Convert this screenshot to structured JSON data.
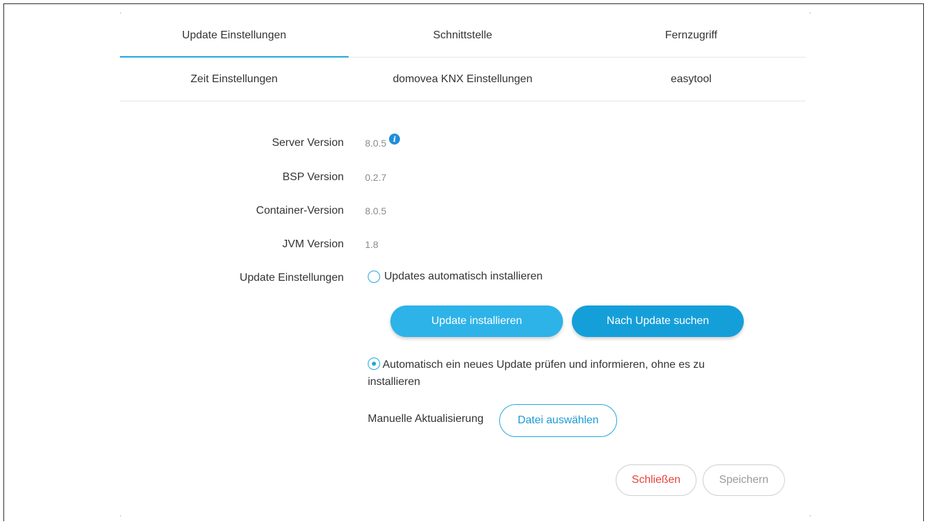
{
  "tabs": {
    "row1": [
      "Update Einstellungen",
      "Schnittstelle",
      "Fernzugriff"
    ],
    "row2": [
      "Zeit Einstellungen",
      "domovea KNX Einstellungen",
      "easytool"
    ],
    "active": "Update Einstellungen"
  },
  "info": {
    "server": {
      "label": "Server Version",
      "value": "8.0.5",
      "icon": "info-icon"
    },
    "bsp": {
      "label": "BSP Version",
      "value": "0.2.7"
    },
    "container": {
      "label": "Container-Version",
      "value": "8.0.5"
    },
    "jvm": {
      "label": "JVM Version",
      "value": "1.8"
    }
  },
  "update_settings": {
    "label": "Update Einstellungen",
    "option_auto_install": "Updates automatisch installieren",
    "option_auto_install_checked": false,
    "option_check_inform": "Automatisch ein neues Update prüfen und informieren, ohne es zu installieren",
    "option_check_inform_checked": true
  },
  "buttons": {
    "install": "Update installieren",
    "search": "Nach Update suchen",
    "choose_file": "Datei auswählen",
    "close": "Schließen",
    "save": "Speichern"
  },
  "manual": {
    "label": "Manuelle Aktualisierung"
  },
  "colors": {
    "accent": "#22a6dc",
    "install_button": "#2db3e8",
    "search_button": "#159fd9",
    "close_text": "#e8413a",
    "disabled_text": "#9a9a9a"
  }
}
